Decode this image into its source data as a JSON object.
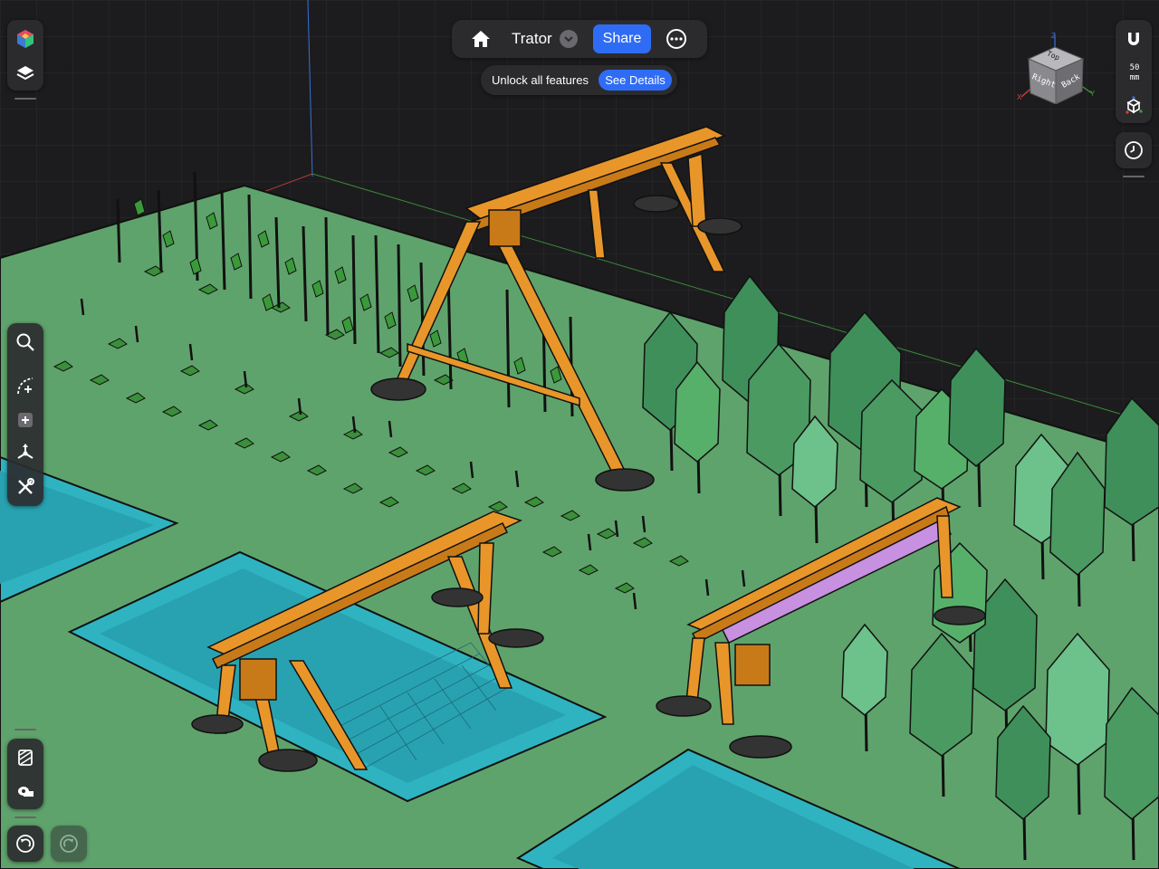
{
  "topbar": {
    "home_icon": "house-icon",
    "document_title": "Trator",
    "title_menu_icon": "chevron-down-icon",
    "share_label": "Share",
    "more_icon": "ellipsis-circle-icon"
  },
  "promo": {
    "text": "Unlock all features",
    "button_label": "See Details"
  },
  "left_top_tools": [
    {
      "name": "app-logo-icon"
    },
    {
      "name": "layers-icon"
    }
  ],
  "left_tools": [
    {
      "name": "search-icon"
    },
    {
      "name": "sketch-arc-icon"
    },
    {
      "name": "add-primitive-icon"
    },
    {
      "name": "transform-icon"
    },
    {
      "name": "tools-icon"
    }
  ],
  "left_bottom_tools": [
    {
      "name": "appearance-icon"
    },
    {
      "name": "measure-icon"
    }
  ],
  "history": {
    "undo_icon": "undo-icon",
    "redo_icon": "redo-icon"
  },
  "right_tools": {
    "snap_icon": "magnet-icon",
    "grid_scale_value": "50",
    "grid_scale_unit": "mm",
    "view_icon": "cube-axes-icon",
    "history_icon": "clock-icon"
  },
  "view_cube": {
    "top": "Top",
    "right": "Right",
    "back": "Back",
    "axes": [
      "X",
      "Y",
      "Z"
    ],
    "axis_colors": {
      "x": "#d9433a",
      "y": "#3aa13a",
      "z": "#3a6fd9"
    }
  },
  "scene": {
    "ground_color": "#5fa36c",
    "water_color": "#2fb3c1",
    "frame_color": "#e8962a",
    "tree_color": "#3f8f5a",
    "background_color": "#1c1c1e"
  }
}
